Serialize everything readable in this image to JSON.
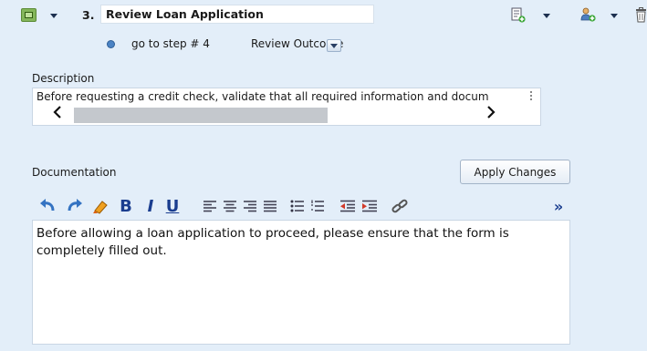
{
  "step": {
    "number": "3.",
    "title": "Review Loan Application"
  },
  "goto": {
    "text": "go to step # 4",
    "target": "Review Outcome"
  },
  "description": {
    "label": "Description",
    "text": "Before requesting a credit check, validate that all required information and docum"
  },
  "documentation": {
    "label": "Documentation",
    "apply_label": "Apply Changes",
    "toolbar": {
      "bold": "B",
      "italic": "I",
      "underline": "U",
      "more": "»"
    },
    "body": "Before allowing a loan application to proceed, please ensure that the form is completely filled out."
  }
}
